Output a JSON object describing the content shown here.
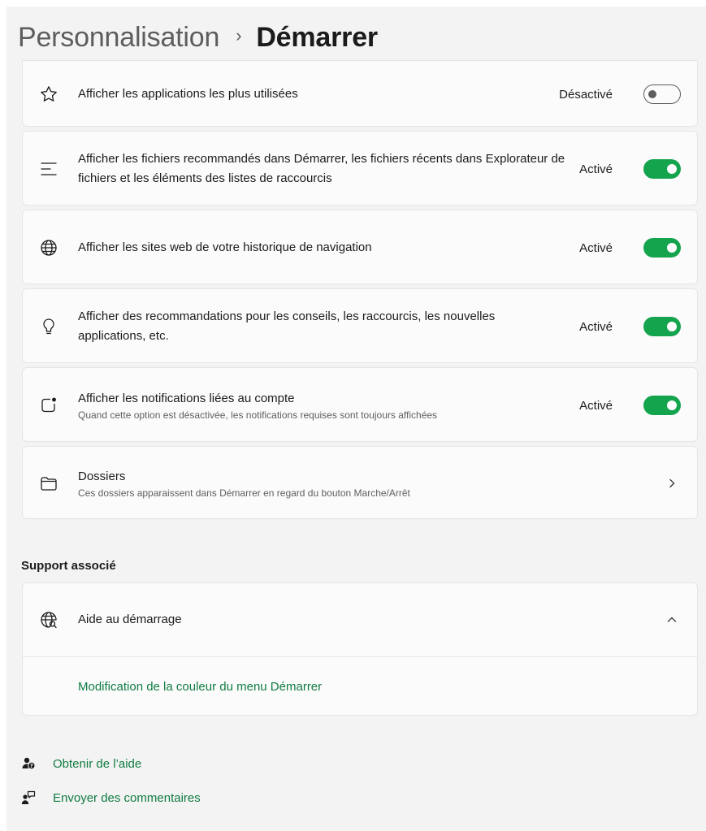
{
  "breadcrumb": {
    "parent": "Personnalisation",
    "separator": "›",
    "current": "Démarrer"
  },
  "settings": [
    {
      "icon": "star-icon",
      "title": "Afficher les applications les plus utilisées",
      "subtitle": "",
      "state_label": "Désactivé",
      "on": false
    },
    {
      "icon": "list-icon",
      "title": "Afficher les fichiers recommandés dans Démarrer, les fichiers récents dans Explorateur de fichiers et les éléments des listes de raccourcis",
      "subtitle": "",
      "state_label": "Activé",
      "on": true
    },
    {
      "icon": "globe-icon",
      "title": "Afficher les sites web de votre historique de navigation",
      "subtitle": "",
      "state_label": "Activé",
      "on": true
    },
    {
      "icon": "lightbulb-icon",
      "title": "Afficher des recommandations pour les conseils, les raccourcis, les nouvelles applications, etc.",
      "subtitle": "",
      "state_label": "Activé",
      "on": true
    },
    {
      "icon": "notification-icon",
      "title": "Afficher les notifications liées au compte",
      "subtitle": "Quand cette option est désactivée, les notifications requises sont toujours affichées",
      "state_label": "Activé",
      "on": true
    }
  ],
  "folders": {
    "icon": "folder-icon",
    "title": "Dossiers",
    "subtitle": "Ces dossiers apparaissent dans Démarrer en regard du bouton Marche/Arrêt"
  },
  "support": {
    "heading": "Support associé",
    "item": {
      "icon": "globe-search-icon",
      "title": "Aide au démarrage",
      "expanded": true
    },
    "link": "Modification de la couleur du menu Démarrer"
  },
  "footer": {
    "help": "Obtenir de l’aide",
    "feedback": "Envoyer des commentaires"
  },
  "colors": {
    "accent": "#14a44d",
    "link": "#107c41",
    "background": "#f3f3f3",
    "card": "#fbfbfb"
  }
}
